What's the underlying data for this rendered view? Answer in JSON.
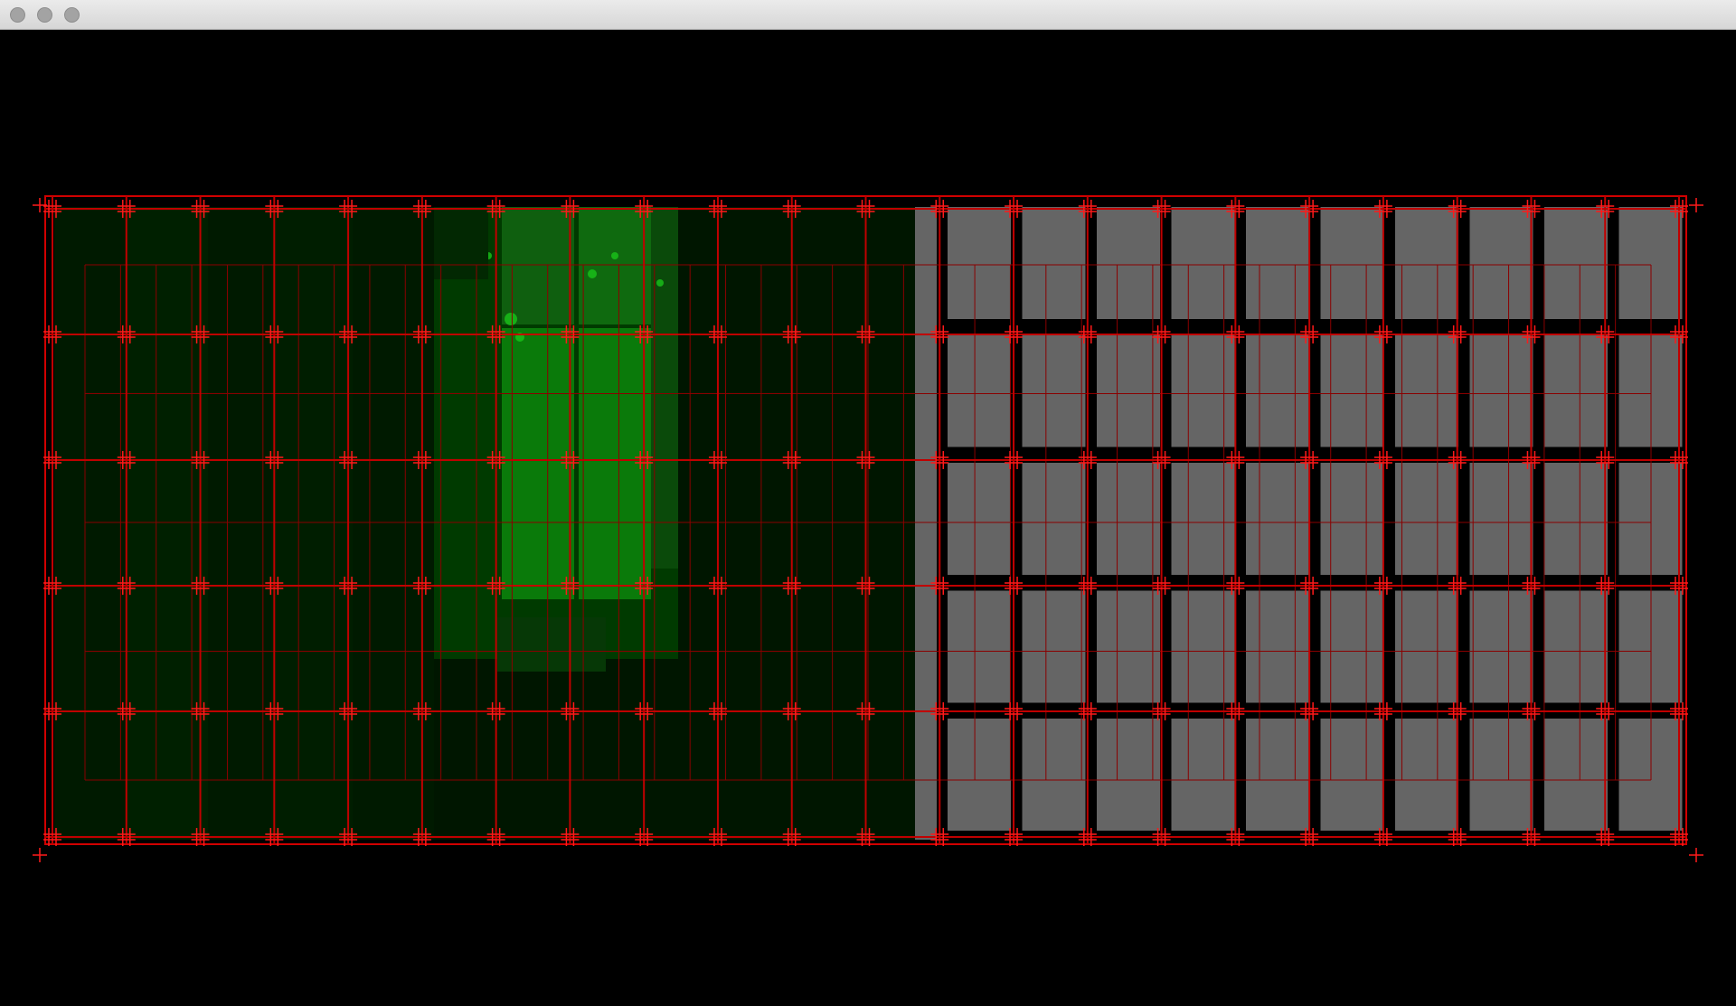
{
  "window": {
    "title": "",
    "buttons": [
      {
        "name": "close",
        "color": "#a3a3a3"
      },
      {
        "name": "minimize",
        "color": "#a3a3a3"
      },
      {
        "name": "zoom",
        "color": "#a3a3a3"
      }
    ]
  },
  "scene": {
    "background": "#000000",
    "overlay_color": "#ff0000",
    "left_panel": {
      "description_color": "#003300",
      "highlight_color": "#19b519"
    },
    "right_panel": {
      "tile_color": "#656565",
      "tile_rows": 5,
      "tile_cols": 10
    },
    "marker_grid": {
      "rows": 6,
      "cols": 23
    }
  }
}
